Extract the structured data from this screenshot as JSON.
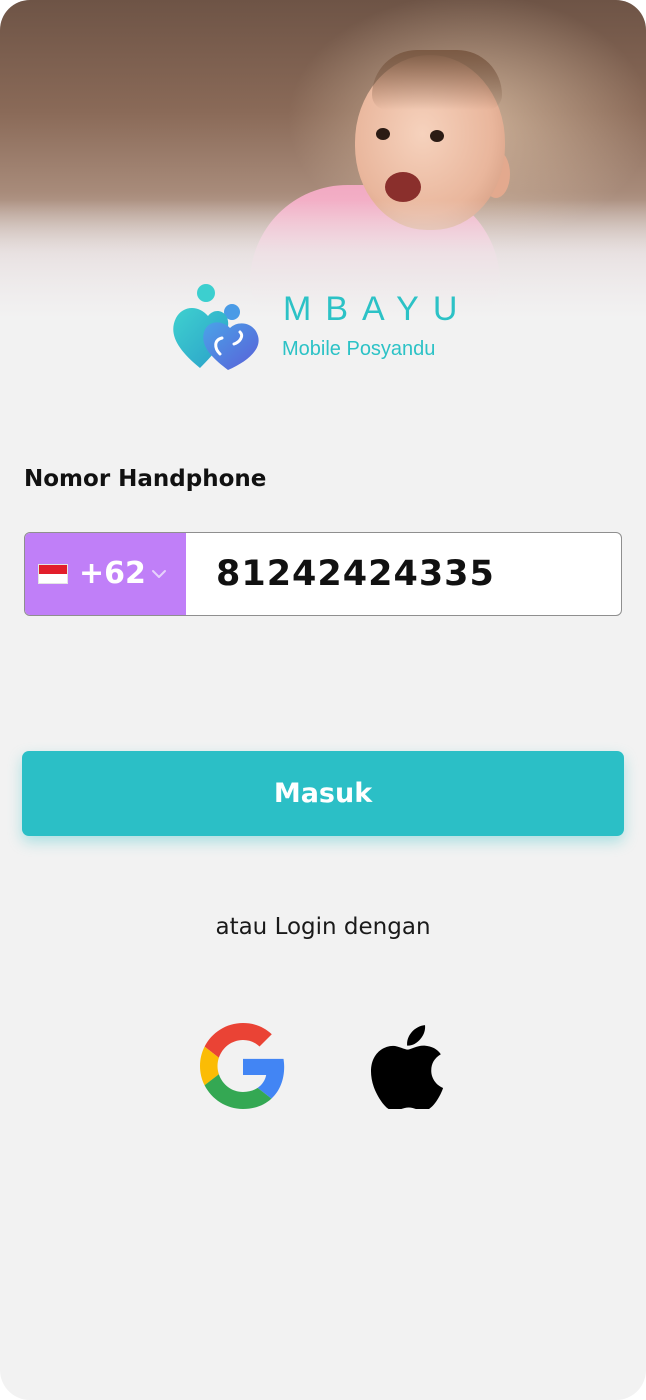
{
  "brand": {
    "name": "MBAYU",
    "tagline": "Mobile Posyandu",
    "accent_color": "#2cc2c6"
  },
  "form": {
    "phone_label": "Nomor Handphone",
    "country": {
      "flag_icon": "indonesia-flag-icon",
      "dial_code": "+62",
      "picker_color": "#c07ff8"
    },
    "phone_value": "81242424335"
  },
  "actions": {
    "login_label": "Masuk",
    "button_color": "#2bbfc6",
    "alt_login_label": "atau Login dengan",
    "social": [
      {
        "icon": "google-icon"
      },
      {
        "icon": "apple-icon"
      }
    ]
  }
}
